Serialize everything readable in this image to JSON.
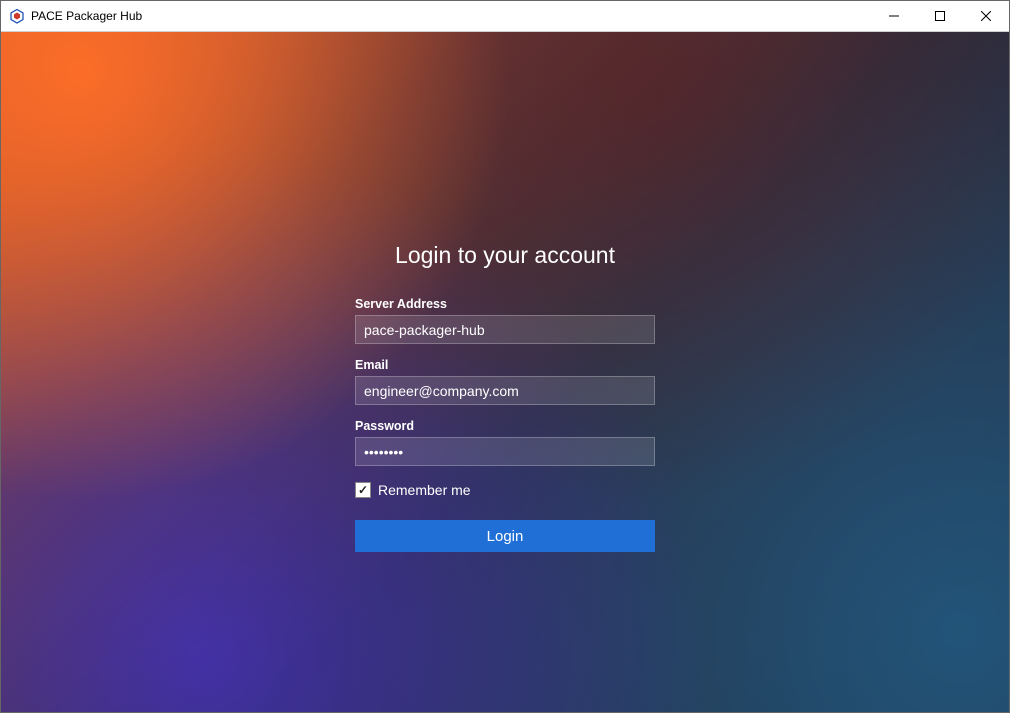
{
  "window": {
    "title": "PACE Packager Hub"
  },
  "login": {
    "heading": "Login to your account",
    "server_label": "Server Address",
    "server_value": "pace-packager-hub",
    "email_label": "Email",
    "email_value": "engineer@company.com",
    "password_label": "Password",
    "password_value": "••••••••",
    "remember_label": "Remember me",
    "remember_checked": true,
    "login_button": "Login"
  },
  "colors": {
    "login_button_bg": "#1f6fd6"
  }
}
